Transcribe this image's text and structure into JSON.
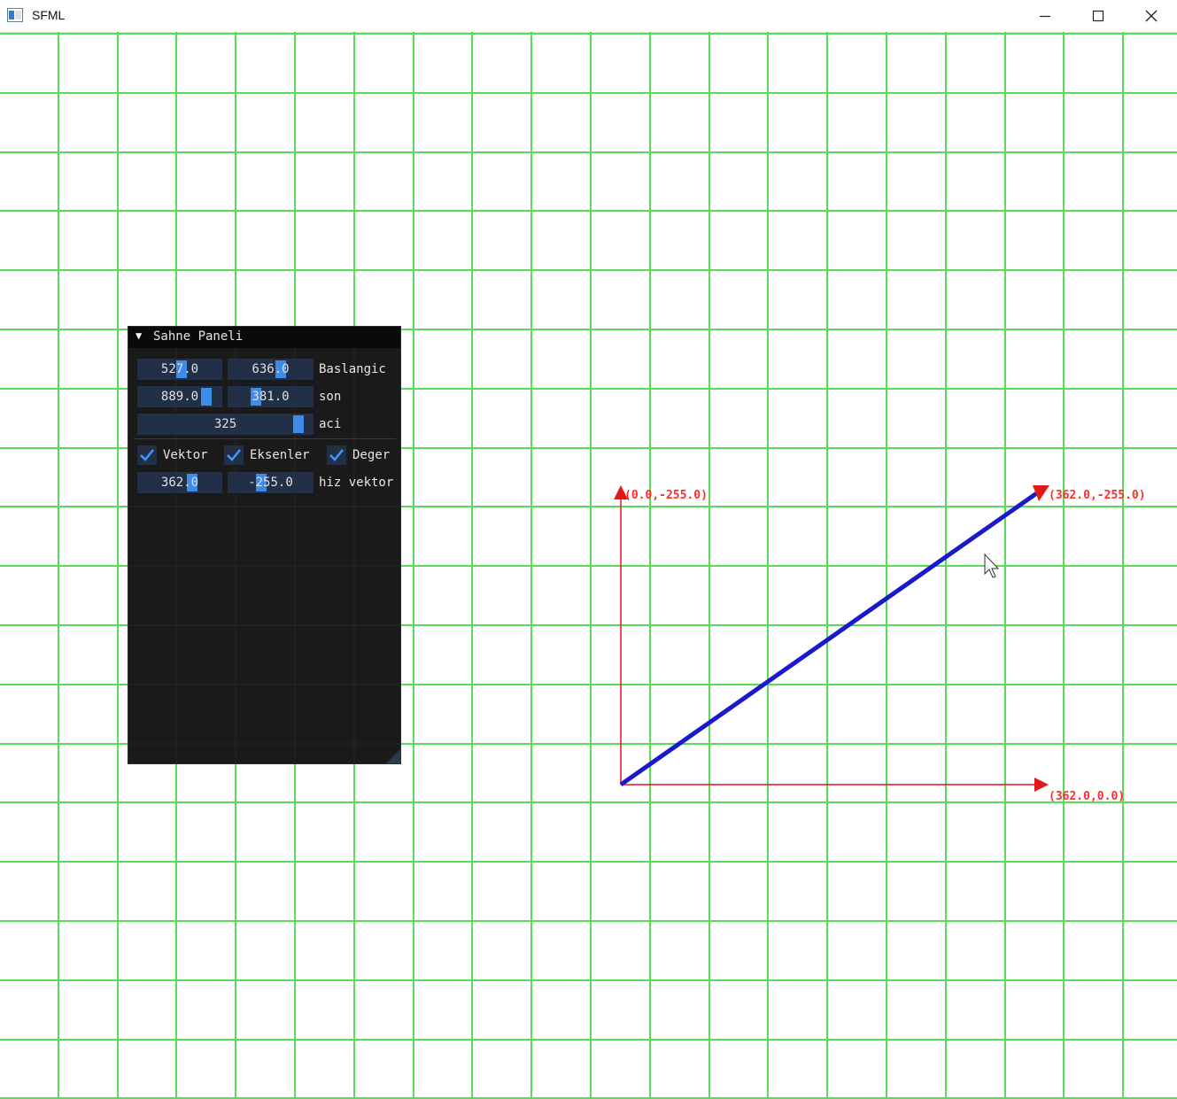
{
  "window": {
    "title": "SFML",
    "controls": [
      "minimize",
      "maximize",
      "close"
    ]
  },
  "colors": {
    "grid": "#55dd55",
    "axis": "#e01818",
    "vector": "#1a1acc",
    "panel_bg": "#1a1a1a",
    "field_bg": "#213047",
    "accent": "#4296fa"
  },
  "panel": {
    "title": "Sahne Paneli",
    "collapse_icon": "triangle-down-icon",
    "baslangic": {
      "x": "527.0",
      "y": "636.0",
      "label": "Baslangic"
    },
    "son": {
      "x": "889.0",
      "y": "381.0",
      "label": "son"
    },
    "aci": {
      "value": "325",
      "label": "aci"
    },
    "checkboxes": [
      {
        "label": "Vektor",
        "checked": true
      },
      {
        "label": "Eksenler",
        "checked": true
      },
      {
        "label": "Deger",
        "checked": true
      }
    ],
    "hiz": {
      "x": "362.0",
      "y": "-255.0",
      "label": "hiz vektor"
    }
  },
  "scene": {
    "labels": {
      "y_axis_end": "(0.0,-255.0)",
      "vector_end": "(362.0,-255.0)",
      "x_axis_end": "(362.0,0.0)"
    }
  }
}
